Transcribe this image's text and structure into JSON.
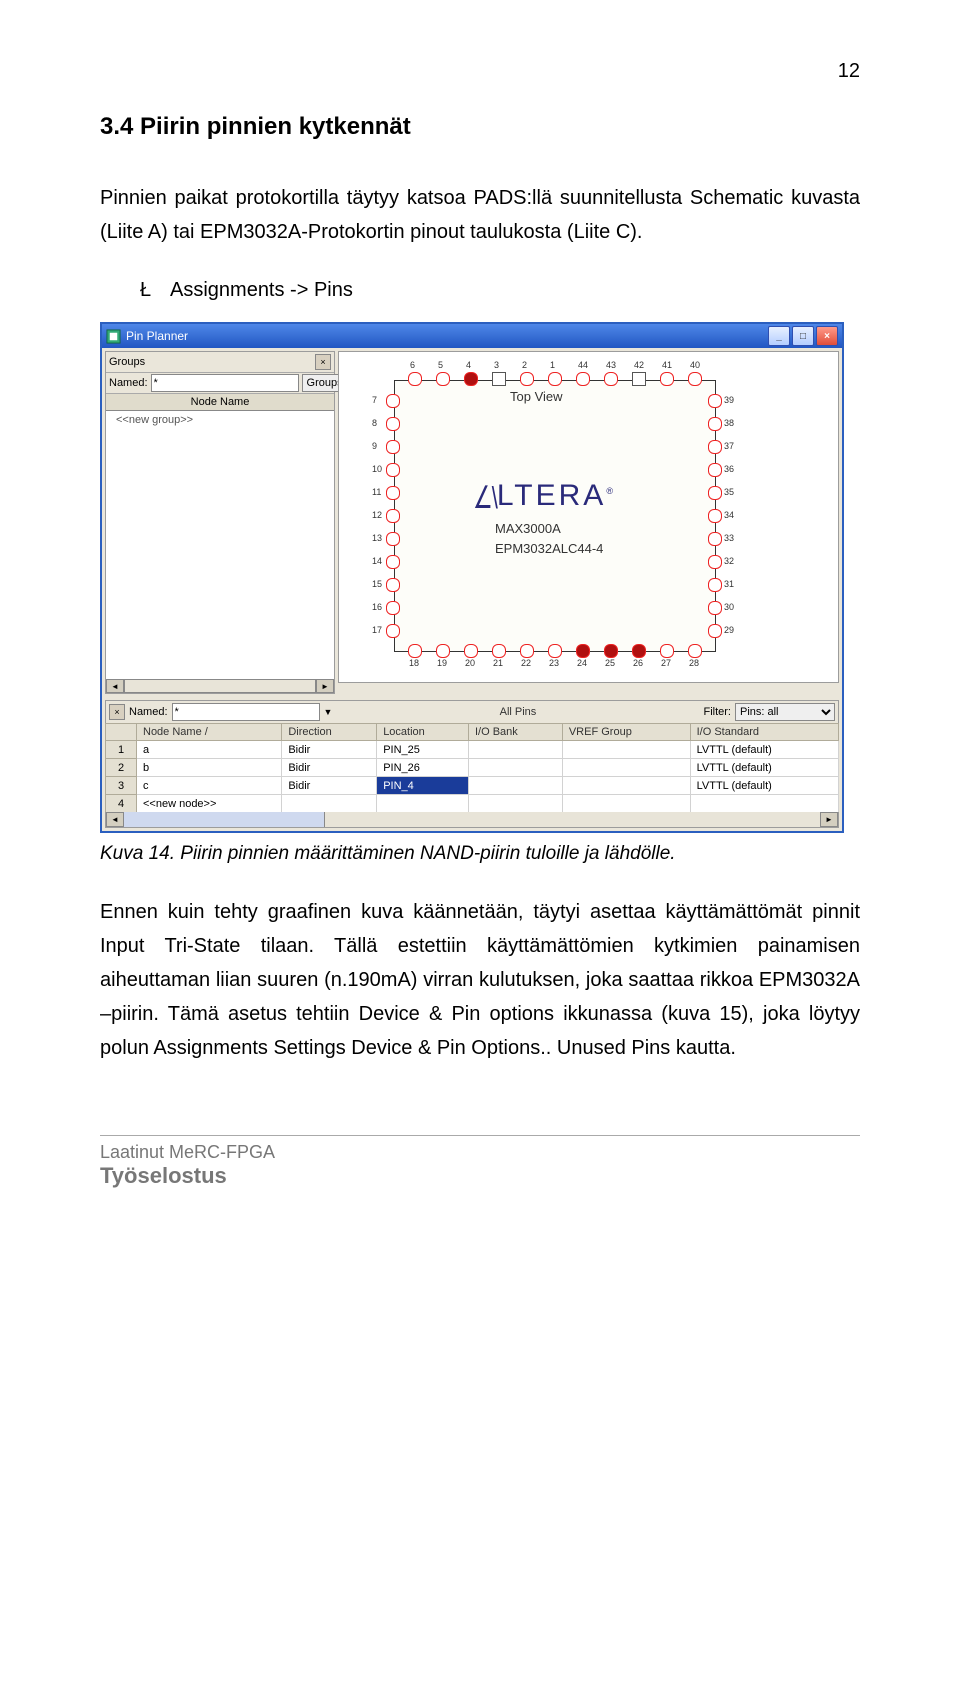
{
  "page_number": "12",
  "heading": "3.4  Piirin pinnien kytkennät",
  "intro_text": "Pinnien paikat protokortilla täytyy katsoa PADS:llä suunnitellusta Schematic kuvasta (Liite A) tai EPM3032A-Protokortin pinout taulukosta (Liite C).",
  "bullet_symbol": "Ł",
  "bullet_text": "Assignments -> Pins",
  "caption": "Kuva 14. Piirin pinnien määrittäminen NAND-piirin tuloille ja lähdölle.",
  "para2": "Ennen kuin tehty graafinen kuva käännetään, täytyi asettaa käyttämättömät pinnit Input Tri-State tilaan. Tällä estettiin käyttämättömien kytkimien painamisen aiheuttaman liian suuren (n.190mA) virran kulutuksen, joka saattaa rikkoa EPM3032A –piirin. Tämä asetus tehtiin Device & Pin options ikkunassa (kuva 15), joka löytyy polun Assignments Settings Device & Pin Options.. Unused Pins kautta.",
  "footer_line1": "Laatinut MeRC-FPGA",
  "footer_line2": "Työselostus",
  "pin_planner": {
    "window_title": "Pin Planner",
    "groups_title": "Groups",
    "named_label": "Named:",
    "named_value": "*",
    "groups_btn": "Groups",
    "node_name_header": "Node Name",
    "new_group": "<<new group>>",
    "top_view": "Top View",
    "altera": "ALTERA",
    "chip_family": "MAX3000A",
    "chip_part": "EPM3032ALC44-4",
    "lower_named_label": "Named:",
    "lower_named_value": "*",
    "all_pins": "All Pins",
    "filter_label": "Filter:",
    "filter_value": "Pins: all",
    "columns": [
      "",
      "Node Name  /",
      "Direction",
      "Location",
      "I/O Bank",
      "VREF Group",
      "I/O Standard"
    ],
    "rows": [
      {
        "n": "1",
        "name": "a",
        "dir": "Bidir",
        "loc": "PIN_25",
        "bank": "",
        "vref": "",
        "io": "LVTTL (default)",
        "sel": false
      },
      {
        "n": "2",
        "name": "b",
        "dir": "Bidir",
        "loc": "PIN_26",
        "bank": "",
        "vref": "",
        "io": "LVTTL (default)",
        "sel": false
      },
      {
        "n": "3",
        "name": "c",
        "dir": "Bidir",
        "loc": "PIN_4",
        "bank": "",
        "vref": "",
        "io": "LVTTL (default)",
        "sel": true
      },
      {
        "n": "4",
        "name": "<<new node>>",
        "dir": "",
        "loc": "",
        "bank": "",
        "vref": "",
        "io": "",
        "sel": false
      }
    ],
    "top_numbers": [
      "6",
      "5",
      "4",
      "3",
      "2",
      "1",
      "44",
      "43",
      "42",
      "41",
      "40"
    ],
    "left_numbers": [
      "7",
      "8",
      "9",
      "10",
      "11",
      "12",
      "13",
      "14",
      "15",
      "16",
      "17"
    ],
    "bottom_numbers": [
      "18",
      "19",
      "20",
      "21",
      "22",
      "23",
      "24",
      "25",
      "26",
      "27",
      "28"
    ],
    "right_numbers": [
      "39",
      "38",
      "37",
      "36",
      "35",
      "34",
      "33",
      "32",
      "31",
      "30",
      "29"
    ]
  }
}
